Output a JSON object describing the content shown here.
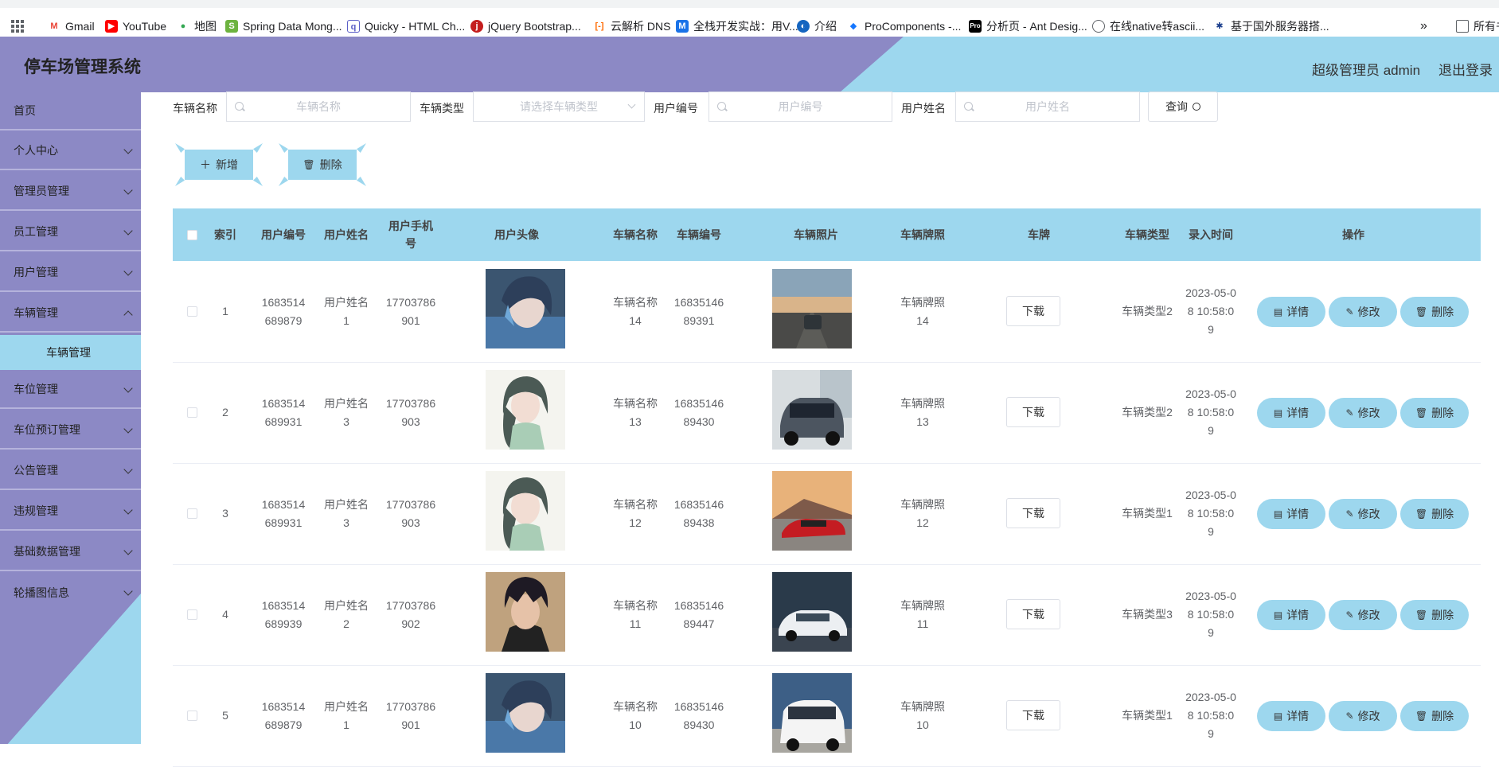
{
  "bookmarks": [
    "Gmail",
    "YouTube",
    "地图",
    "Spring Data Mong...",
    "Quicky - HTML Ch...",
    "jQuery Bootstrap...",
    "云解析 DNS",
    "全栈开发实战：用V...",
    "介绍",
    "ProComponents -...",
    "分析页 - Ant Desig...",
    "在线native转ascii...",
    "基于国外服务器搭...",
    "所有书"
  ],
  "header": {
    "title": "停车场管理系统",
    "admin": "超级管理员 admin",
    "logout": "退出登录"
  },
  "sidebar": {
    "items": [
      "首页",
      "个人中心",
      "管理员管理",
      "员工管理",
      "用户管理",
      "车辆管理",
      "车位管理",
      "车位预订管理",
      "公告管理",
      "违规管理",
      "基础数据管理",
      "轮播图信息"
    ],
    "active_sub": "车辆管理"
  },
  "search": {
    "label_vehicle_name": "车辆名称",
    "ph_vehicle_name": "车辆名称",
    "label_vehicle_type": "车辆类型",
    "ph_vehicle_type": "请选择车辆类型",
    "label_user_no": "用户编号",
    "ph_user_no": "用户编号",
    "label_user_name": "用户姓名",
    "ph_user_name": "用户姓名",
    "query": "查询"
  },
  "actions": {
    "add": "新增",
    "delete": "删除"
  },
  "table": {
    "headers": [
      "索引",
      "用户编号",
      "用户姓名",
      "用户手机号",
      "用户头像",
      "车辆名称",
      "车辆编号",
      "车辆照片",
      "车辆牌照",
      "车牌",
      "车辆类型",
      "录入时间",
      "操作"
    ],
    "download": "下载",
    "op_detail": "详情",
    "op_edit": "修改",
    "op_delete": "删除",
    "rows": [
      {
        "index": "1",
        "user_no": "1683514689879",
        "user_name": "用户姓名1",
        "phone": "17703786901",
        "vehicle_name": "车辆名称14",
        "vehicle_no": "1683514689391",
        "plate": "车辆牌照14",
        "type": "车辆类型2",
        "time": "2023-05-08 10:58:09",
        "avatar": "boy-blue",
        "car": "road"
      },
      {
        "index": "2",
        "user_no": "1683514689931",
        "user_name": "用户姓名3",
        "phone": "17703786903",
        "vehicle_name": "车辆名称13",
        "vehicle_no": "1683514689430",
        "plate": "车辆牌照13",
        "type": "车辆类型2",
        "time": "2023-05-08 10:58:09",
        "avatar": "girl",
        "car": "grey"
      },
      {
        "index": "3",
        "user_no": "1683514689931",
        "user_name": "用户姓名3",
        "phone": "17703786903",
        "vehicle_name": "车辆名称12",
        "vehicle_no": "1683514689438",
        "plate": "车辆牌照12",
        "type": "车辆类型1",
        "time": "2023-05-08 10:58:09",
        "avatar": "girl",
        "car": "red"
      },
      {
        "index": "4",
        "user_no": "1683514689939",
        "user_name": "用户姓名2",
        "phone": "17703786902",
        "vehicle_name": "车辆名称11",
        "vehicle_no": "1683514689447",
        "plate": "车辆牌照11",
        "type": "车辆类型3",
        "time": "2023-05-08 10:58:09",
        "avatar": "boy-dark",
        "car": "white"
      },
      {
        "index": "5",
        "user_no": "1683514689879",
        "user_name": "用户姓名1",
        "phone": "17703786901",
        "vehicle_name": "车辆名称10",
        "vehicle_no": "1683514689430",
        "plate": "车辆牌照10",
        "type": "车辆类型1",
        "time": "2023-05-08 10:58:09",
        "avatar": "boy-blue",
        "car": "van"
      }
    ]
  },
  "colors": {
    "purple": "#8c89c5",
    "lightblue": "#9dd7ee"
  }
}
